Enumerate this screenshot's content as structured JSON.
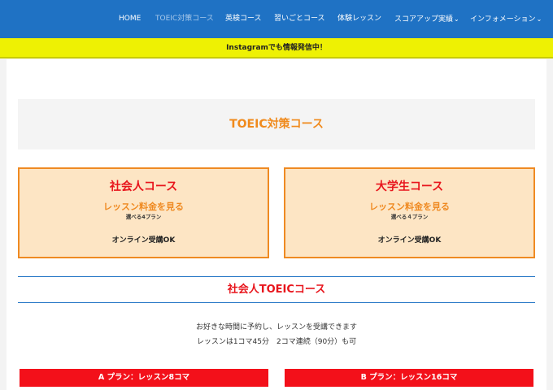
{
  "nav": {
    "items": [
      {
        "label": "HOME"
      },
      {
        "label": "TOEIC対策コース"
      },
      {
        "label": "英検コース"
      },
      {
        "label": "習いごとコース"
      },
      {
        "label": "体験レッスン"
      },
      {
        "label": "スコアアップ実績",
        "chevron": "⌄"
      },
      {
        "label": "インフォメーション",
        "chevron": "⌄"
      }
    ],
    "active_index": 1
  },
  "banner": {
    "text": "Instagramでも情報発信中！"
  },
  "page": {
    "title": "TOEIC対策コース"
  },
  "courses": [
    {
      "title": "社会人コース",
      "link": "レッスン料金を見る",
      "sub": "選べる4プラン",
      "online": "オンライン受講OK"
    },
    {
      "title": "大学生コース",
      "link": "レッスン料金を見る",
      "sub": "選べる４プラン",
      "online": "オンライン受講OK"
    }
  ],
  "section": {
    "title": "社会人TOEICコース",
    "desc1": "お好きな時間に予約し、レッスンを受講できます",
    "desc2": "レッスンは1コマ45分　2コマ連続（90分）も可"
  },
  "plans": [
    {
      "label": "A プラン：レッスン8コマ"
    },
    {
      "label": "B プラン：レッスン16コマ"
    }
  ],
  "colors": {
    "nav_bg": "#1f72c4",
    "banner_bg": "#eef103",
    "accent_orange": "#ef8a22",
    "accent_red": "#e8151c",
    "card_bg": "#fde5c4"
  }
}
